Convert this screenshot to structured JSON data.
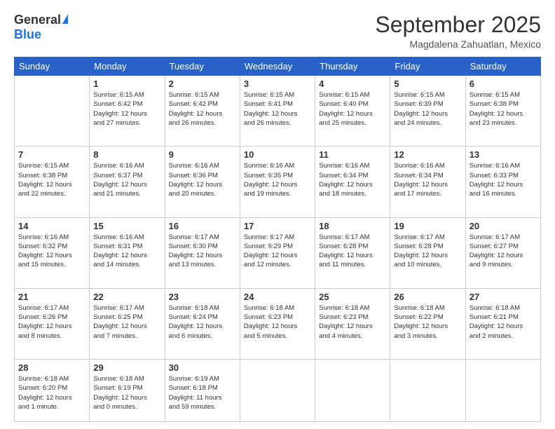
{
  "header": {
    "logo_general": "General",
    "logo_blue": "Blue",
    "month_title": "September 2025",
    "location": "Magdalena Zahuatlan, Mexico"
  },
  "weekdays": [
    "Sunday",
    "Monday",
    "Tuesday",
    "Wednesday",
    "Thursday",
    "Friday",
    "Saturday"
  ],
  "weeks": [
    [
      {
        "day": "",
        "info": ""
      },
      {
        "day": "1",
        "info": "Sunrise: 6:15 AM\nSunset: 6:42 PM\nDaylight: 12 hours\nand 27 minutes."
      },
      {
        "day": "2",
        "info": "Sunrise: 6:15 AM\nSunset: 6:42 PM\nDaylight: 12 hours\nand 26 minutes."
      },
      {
        "day": "3",
        "info": "Sunrise: 6:15 AM\nSunset: 6:41 PM\nDaylight: 12 hours\nand 26 minutes."
      },
      {
        "day": "4",
        "info": "Sunrise: 6:15 AM\nSunset: 6:40 PM\nDaylight: 12 hours\nand 25 minutes."
      },
      {
        "day": "5",
        "info": "Sunrise: 6:15 AM\nSunset: 6:39 PM\nDaylight: 12 hours\nand 24 minutes."
      },
      {
        "day": "6",
        "info": "Sunrise: 6:15 AM\nSunset: 6:38 PM\nDaylight: 12 hours\nand 23 minutes."
      }
    ],
    [
      {
        "day": "7",
        "info": "Sunrise: 6:15 AM\nSunset: 6:38 PM\nDaylight: 12 hours\nand 22 minutes."
      },
      {
        "day": "8",
        "info": "Sunrise: 6:16 AM\nSunset: 6:37 PM\nDaylight: 12 hours\nand 21 minutes."
      },
      {
        "day": "9",
        "info": "Sunrise: 6:16 AM\nSunset: 6:36 PM\nDaylight: 12 hours\nand 20 minutes."
      },
      {
        "day": "10",
        "info": "Sunrise: 6:16 AM\nSunset: 6:35 PM\nDaylight: 12 hours\nand 19 minutes."
      },
      {
        "day": "11",
        "info": "Sunrise: 6:16 AM\nSunset: 6:34 PM\nDaylight: 12 hours\nand 18 minutes."
      },
      {
        "day": "12",
        "info": "Sunrise: 6:16 AM\nSunset: 6:34 PM\nDaylight: 12 hours\nand 17 minutes."
      },
      {
        "day": "13",
        "info": "Sunrise: 6:16 AM\nSunset: 6:33 PM\nDaylight: 12 hours\nand 16 minutes."
      }
    ],
    [
      {
        "day": "14",
        "info": "Sunrise: 6:16 AM\nSunset: 6:32 PM\nDaylight: 12 hours\nand 15 minutes."
      },
      {
        "day": "15",
        "info": "Sunrise: 6:16 AM\nSunset: 6:31 PM\nDaylight: 12 hours\nand 14 minutes."
      },
      {
        "day": "16",
        "info": "Sunrise: 6:17 AM\nSunset: 6:30 PM\nDaylight: 12 hours\nand 13 minutes."
      },
      {
        "day": "17",
        "info": "Sunrise: 6:17 AM\nSunset: 6:29 PM\nDaylight: 12 hours\nand 12 minutes."
      },
      {
        "day": "18",
        "info": "Sunrise: 6:17 AM\nSunset: 6:28 PM\nDaylight: 12 hours\nand 11 minutes."
      },
      {
        "day": "19",
        "info": "Sunrise: 6:17 AM\nSunset: 6:28 PM\nDaylight: 12 hours\nand 10 minutes."
      },
      {
        "day": "20",
        "info": "Sunrise: 6:17 AM\nSunset: 6:27 PM\nDaylight: 12 hours\nand 9 minutes."
      }
    ],
    [
      {
        "day": "21",
        "info": "Sunrise: 6:17 AM\nSunset: 6:26 PM\nDaylight: 12 hours\nand 8 minutes."
      },
      {
        "day": "22",
        "info": "Sunrise: 6:17 AM\nSunset: 6:25 PM\nDaylight: 12 hours\nand 7 minutes."
      },
      {
        "day": "23",
        "info": "Sunrise: 6:18 AM\nSunset: 6:24 PM\nDaylight: 12 hours\nand 6 minutes."
      },
      {
        "day": "24",
        "info": "Sunrise: 6:18 AM\nSunset: 6:23 PM\nDaylight: 12 hours\nand 5 minutes."
      },
      {
        "day": "25",
        "info": "Sunrise: 6:18 AM\nSunset: 6:23 PM\nDaylight: 12 hours\nand 4 minutes."
      },
      {
        "day": "26",
        "info": "Sunrise: 6:18 AM\nSunset: 6:22 PM\nDaylight: 12 hours\nand 3 minutes."
      },
      {
        "day": "27",
        "info": "Sunrise: 6:18 AM\nSunset: 6:21 PM\nDaylight: 12 hours\nand 2 minutes."
      }
    ],
    [
      {
        "day": "28",
        "info": "Sunrise: 6:18 AM\nSunset: 6:20 PM\nDaylight: 12 hours\nand 1 minute."
      },
      {
        "day": "29",
        "info": "Sunrise: 6:18 AM\nSunset: 6:19 PM\nDaylight: 12 hours\nand 0 minutes."
      },
      {
        "day": "30",
        "info": "Sunrise: 6:19 AM\nSunset: 6:18 PM\nDaylight: 11 hours\nand 59 minutes."
      },
      {
        "day": "",
        "info": ""
      },
      {
        "day": "",
        "info": ""
      },
      {
        "day": "",
        "info": ""
      },
      {
        "day": "",
        "info": ""
      }
    ]
  ]
}
